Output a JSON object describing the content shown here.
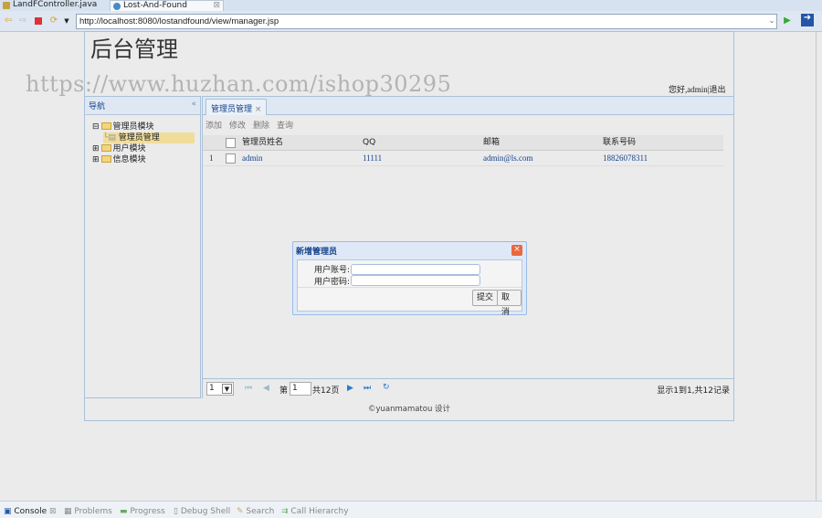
{
  "editor_tabs": [
    {
      "label": "LandFController.java"
    },
    {
      "label": "Lost-And-Found"
    }
  ],
  "browser": {
    "url": "http://localhost:8080/lostandfound/view/manager.jsp"
  },
  "page": {
    "title": "后台管理",
    "watermark": "https://www.huzhan.com/ishop30295",
    "greeting": "您好,admin|退出"
  },
  "nav": {
    "title": "导航",
    "collapse": "«",
    "items": [
      {
        "label": "管理员模块"
      },
      {
        "label": "管理员管理"
      },
      {
        "label": "用户模块"
      },
      {
        "label": "信息模块"
      }
    ]
  },
  "panel": {
    "tab": "管理员管理",
    "tab_close": "×",
    "toolbar": [
      "添加",
      "修改",
      "删除",
      "查询"
    ],
    "columns": [
      "管理员姓名",
      "QQ",
      "邮箱",
      "联系号码"
    ],
    "rows": [
      {
        "num": "1",
        "name": "admin",
        "qq": "11111",
        "email": "admin@ls.com",
        "phone": "18826078311"
      }
    ]
  },
  "pager": {
    "page_size": "1",
    "page_label": "第",
    "page": "1",
    "total_pages": "共12页",
    "summary": "显示1到1,共12记录"
  },
  "footer": "©yuanmamatou 设计",
  "dialog": {
    "title": "新增管理员",
    "account_label": "用户账号:",
    "password_label": "用户密码:",
    "submit": "提交",
    "cancel": "取消"
  },
  "bottom_tabs": [
    "Console",
    "Problems",
    "Progress",
    "Debug Shell",
    "Search",
    "Call Hierarchy"
  ]
}
